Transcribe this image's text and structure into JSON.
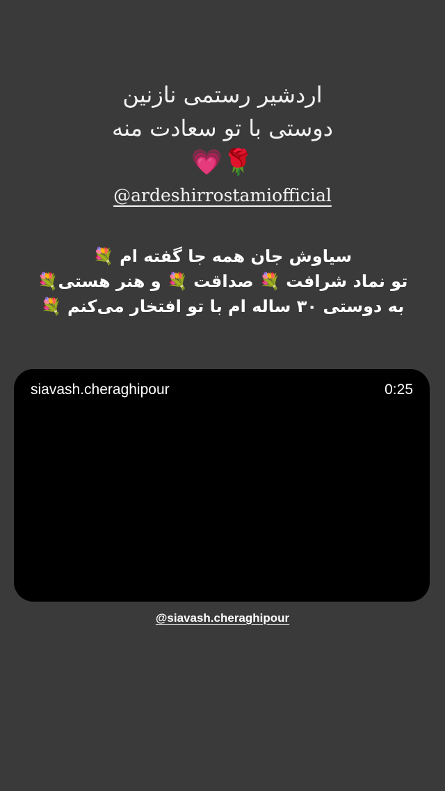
{
  "story": {
    "background_color": "#3a3a3a",
    "title_lines": [
      "اردشیر رستمی نازنین",
      "دوستی با تو سعادت منه"
    ],
    "emojis": {
      "rose": "🌹",
      "heart": "💗"
    },
    "mention_primary": "@ardeshirrostamiofficial",
    "message_lines": [
      "سیاوش جان همه جا گفته ام 💐",
      "تو نماد شرافت 💐 صداقت 💐 و هنر هستی💐",
      "به دوستی ۳۰ ساله ام با تو افتخار می‌کنم 💐"
    ],
    "video": {
      "username": "siavash.cheraghipour",
      "duration": "0:25",
      "background_color": "#000000"
    },
    "mention_secondary": "@siavash.cheraghipour"
  }
}
